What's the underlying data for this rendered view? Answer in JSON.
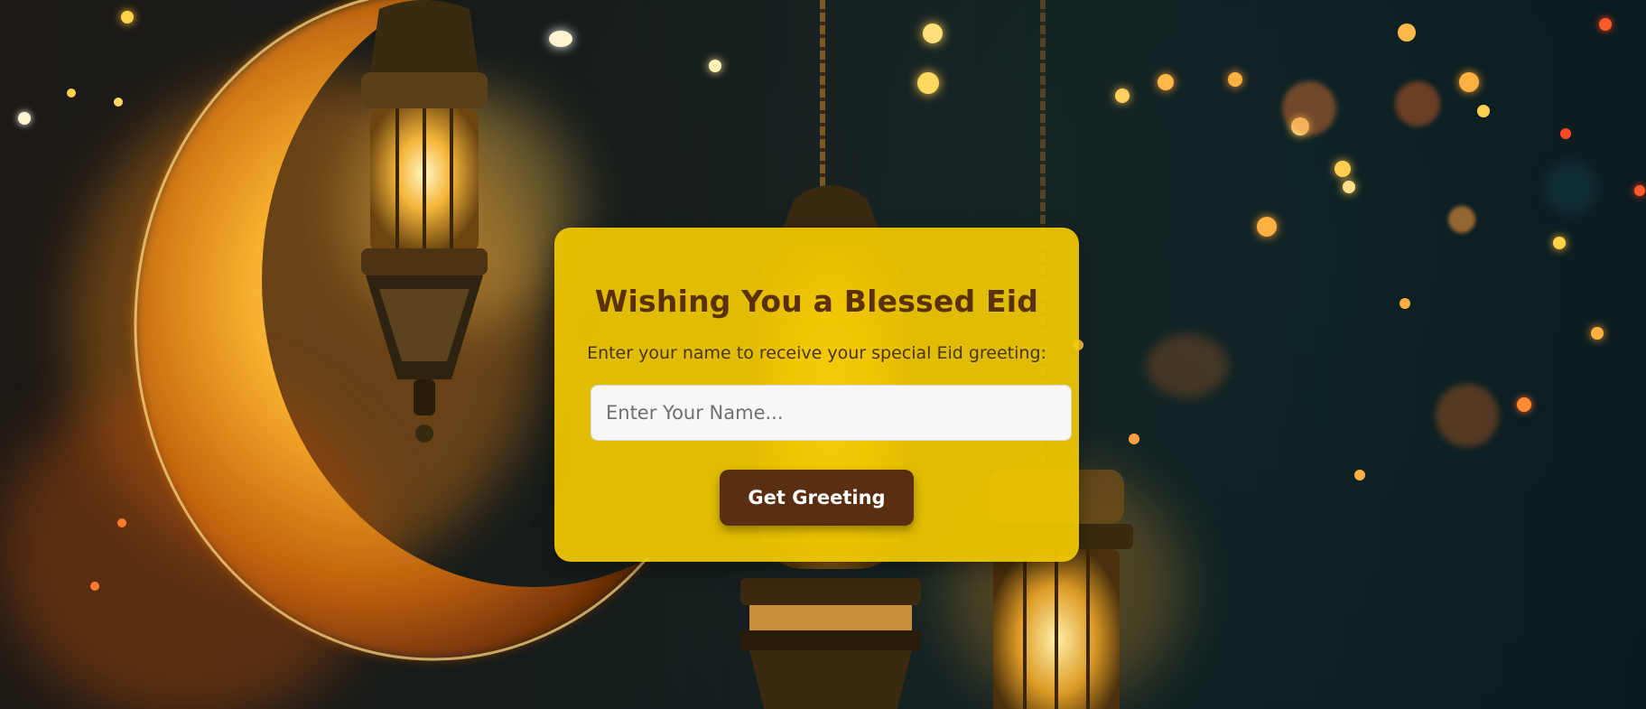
{
  "card": {
    "title": "Wishing You a Blessed Eid",
    "subtitle": "Enter your name to receive your special Eid greeting:",
    "input_placeholder": "Enter Your Name...",
    "input_value": "",
    "button_label": "Get Greeting"
  },
  "colors": {
    "card_background": "#F0C800",
    "title_text": "#5A3008",
    "button_background": "#5A2E10",
    "button_text": "#FFFFFF"
  },
  "background": {
    "description_icon": "crescent-moon-and-lanterns-background"
  }
}
